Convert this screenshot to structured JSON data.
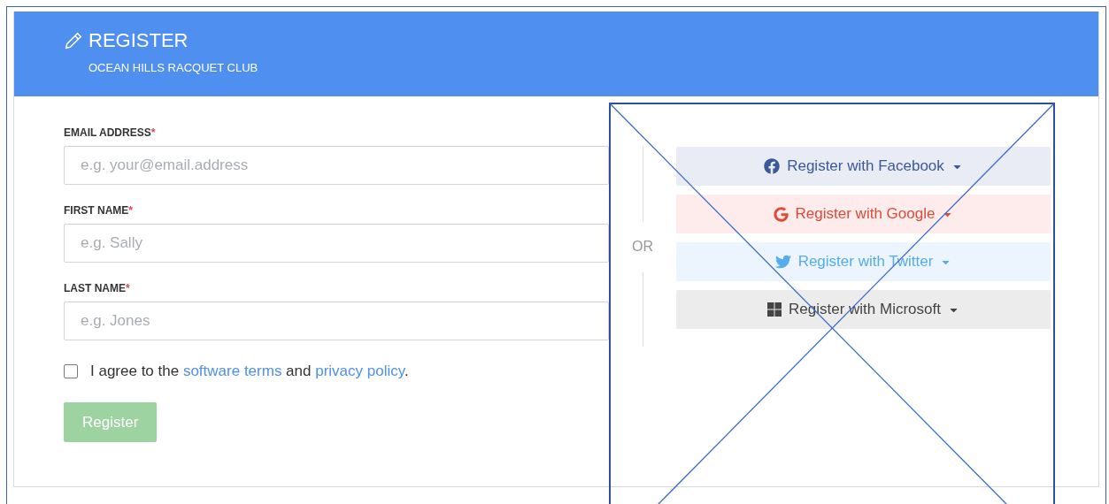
{
  "header": {
    "title": "REGISTER",
    "subtitle": "OCEAN HILLS RACQUET CLUB"
  },
  "fields": [
    {
      "label": "EMAIL ADDRESS",
      "required_mark": "*",
      "placeholder": "e.g. your@email.address"
    },
    {
      "label": "FIRST NAME",
      "required_mark": "*",
      "placeholder": "e.g. Sally"
    },
    {
      "label": "LAST NAME",
      "required_mark": "*",
      "placeholder": "e.g. Jones"
    }
  ],
  "agree": {
    "checked": false,
    "parts": [
      {
        "kind": "text",
        "text": "I agree to the "
      },
      {
        "kind": "link",
        "text": "software terms"
      },
      {
        "kind": "text",
        "text": " and "
      },
      {
        "kind": "link",
        "text": "privacy policy"
      },
      {
        "kind": "text",
        "text": "."
      }
    ]
  },
  "submit": {
    "label": "Register",
    "disabled": true
  },
  "divider": {
    "label": "OR"
  },
  "social_buttons": [
    {
      "kind": "facebook",
      "label": "Register with Facebook"
    },
    {
      "kind": "google",
      "label": "Register with Google"
    },
    {
      "kind": "twitter",
      "label": "Register with Twitter"
    },
    {
      "kind": "microsoft",
      "label": "Register with Microsoft"
    }
  ]
}
